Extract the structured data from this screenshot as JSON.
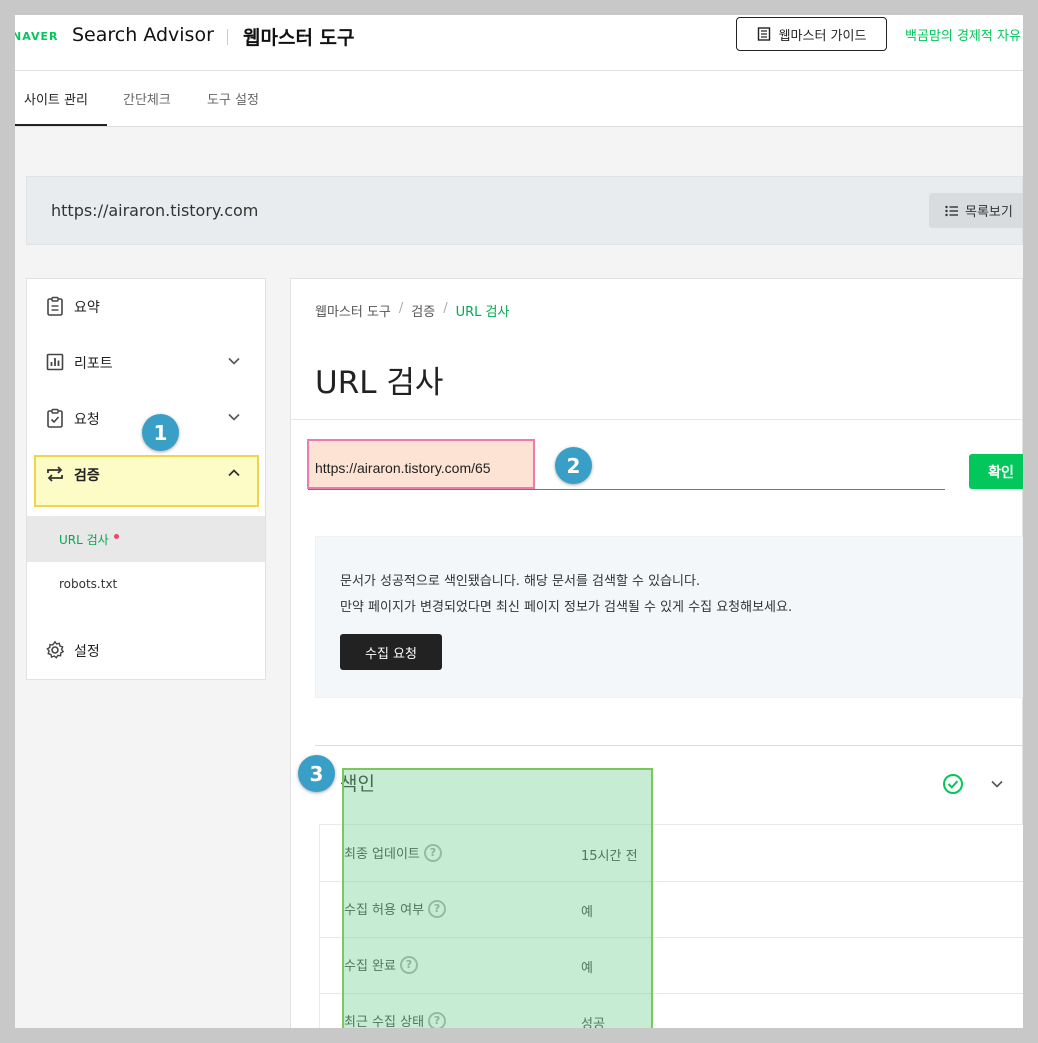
{
  "header": {
    "naver_logo": "NAVER",
    "app_title": "Search Advisor",
    "tool_title": "웹마스터 도구",
    "guide_button": "웹마스터 가이드",
    "user_link": "백곰맘의 경제적 자유"
  },
  "tabs": [
    {
      "label": "사이트 관리",
      "active": true
    },
    {
      "label": "간단체크",
      "active": false
    },
    {
      "label": "도구 설정",
      "active": false
    }
  ],
  "site": {
    "url": "https://airaron.tistory.com",
    "list_button": "목록보기"
  },
  "sidebar": {
    "items": [
      {
        "label": "요약",
        "icon": "clipboard-icon"
      },
      {
        "label": "리포트",
        "icon": "chart-icon"
      },
      {
        "label": "요청",
        "icon": "clipboard-check-icon"
      },
      {
        "label": "검증",
        "icon": "repeat-icon"
      },
      {
        "label": "설정",
        "icon": "gear-icon"
      }
    ],
    "subitems": [
      {
        "label": "URL 검사",
        "active": true
      },
      {
        "label": "robots.txt",
        "active": false
      }
    ]
  },
  "steps": [
    "1",
    "2",
    "3"
  ],
  "main": {
    "breadcrumb": [
      "웹마스터 도구",
      "검증",
      "URL 검사"
    ],
    "title": "URL 검사",
    "url_input_value": "https://airaron.tistory.com/65",
    "confirm_button": "확인",
    "info_line1": "문서가 성공적으로 색인됐습니다. 해당 문서를 검색할 수 있습니다.",
    "info_line2": "만약 페이지가 변경되었다면 최신 페이지 정보가 검색될 수 있게 수집 요청해보세요.",
    "request_button": "수집 요청",
    "index_title": "색인",
    "index_rows": [
      {
        "label": "최종 업데이트",
        "value": "15시간 전"
      },
      {
        "label": "수집 허용 여부",
        "value": "예"
      },
      {
        "label": "수집 완료",
        "value": "예"
      },
      {
        "label": "최근 수집 상태",
        "value": "성공"
      }
    ]
  },
  "colors": {
    "brand_green": "#03c75a",
    "step_blue": "#3a9fc7",
    "highlight_yellow": "#fdfbc6",
    "highlight_pink": "#fde3d4"
  }
}
